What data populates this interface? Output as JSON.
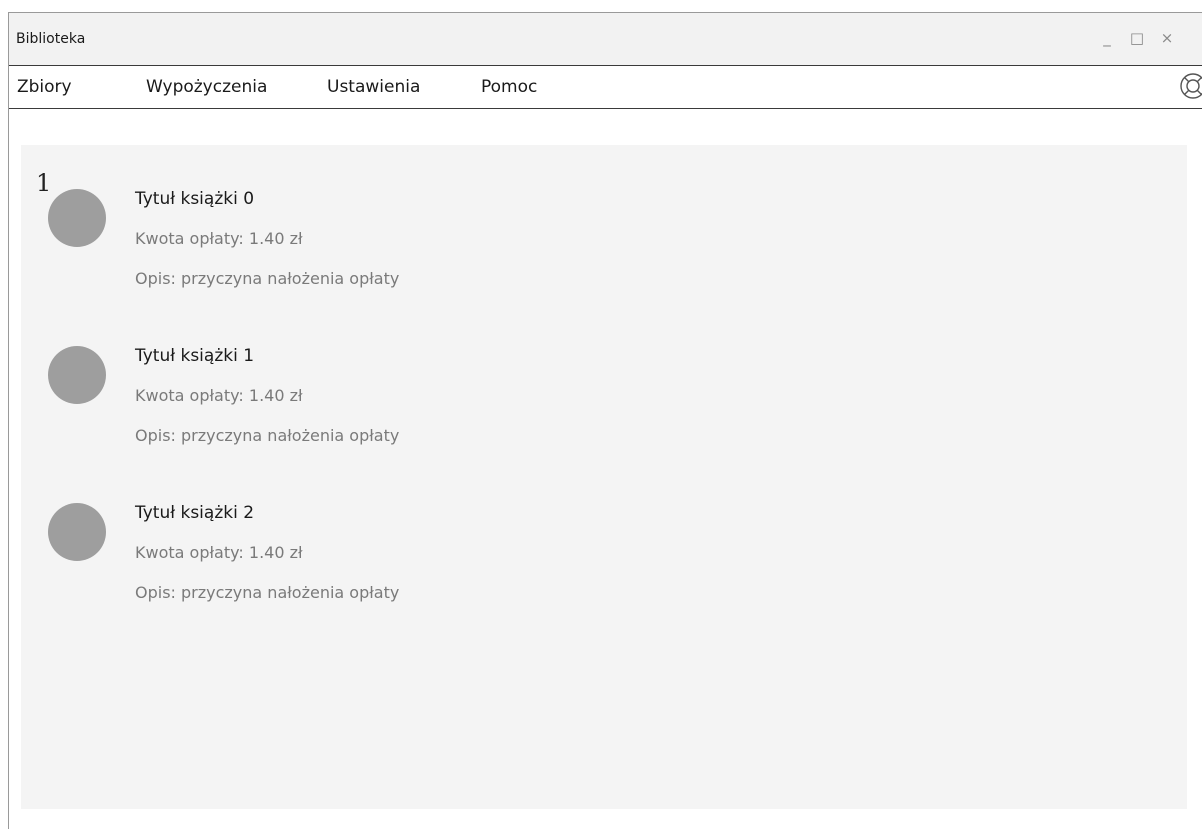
{
  "window": {
    "title": "Biblioteka",
    "controls": {
      "minimize": "_",
      "maximize": "□",
      "close": "×"
    }
  },
  "menu": {
    "items": [
      {
        "label": "Zbiory"
      },
      {
        "label": "Wypożyczenia"
      },
      {
        "label": "Ustawienia"
      },
      {
        "label": "Pomoc"
      }
    ],
    "help_icon": "lifebuoy-icon"
  },
  "content": {
    "page_number": "1",
    "fees": [
      {
        "title": "Tytuł książki 0",
        "amount": "Kwota opłaty: 1.40 zł",
        "description": "Opis: przyczyna nałożenia opłaty"
      },
      {
        "title": "Tytuł książki 1",
        "amount": "Kwota opłaty: 1.40 zł",
        "description": "Opis: przyczyna nałożenia opłaty"
      },
      {
        "title": "Tytuł książki 2",
        "amount": "Kwota opłaty: 1.40 zł",
        "description": "Opis: przyczyna nałożenia opłaty"
      }
    ]
  },
  "colors": {
    "avatar": "#9e9e9e",
    "content_background": "#f4f4f4",
    "titlebar_background": "#f2f2f2",
    "secondary_text": "#7a7a7a"
  }
}
